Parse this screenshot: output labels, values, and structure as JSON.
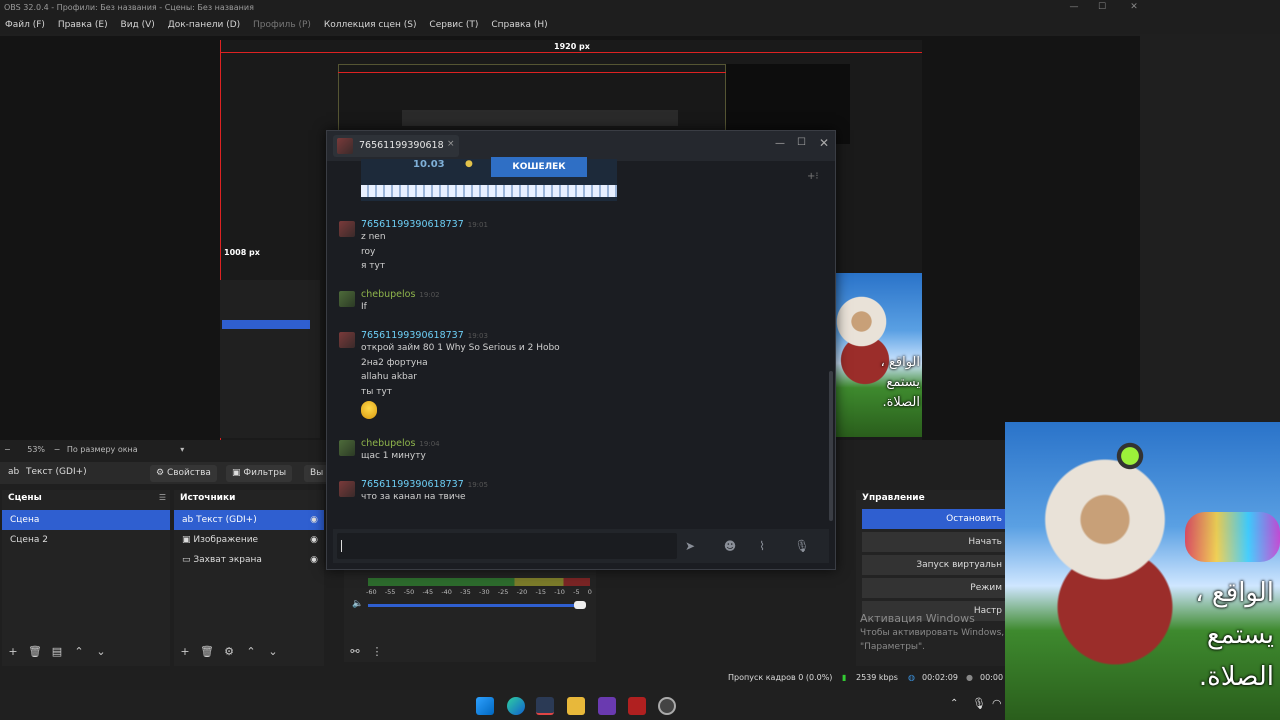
{
  "window": {
    "title": "OBS 32.0.4 - Профили: Без названия - Сцены: Без названия"
  },
  "menu": [
    {
      "label": "Файл (F)",
      "dim": false
    },
    {
      "label": "Правка (E)",
      "dim": false
    },
    {
      "label": "Вид (V)",
      "dim": false
    },
    {
      "label": "Док-панели (D)",
      "dim": false
    },
    {
      "label": "Профиль (P)",
      "dim": true
    },
    {
      "label": "Коллекция сцен (S)",
      "dim": false
    },
    {
      "label": "Сервис (T)",
      "dim": false
    },
    {
      "label": "Справка (H)",
      "dim": false
    }
  ],
  "preview": {
    "width_label": "1920 px",
    "height_label": "1008 px"
  },
  "zoom": {
    "value": "53%",
    "mode": "По размеру окна"
  },
  "source_bar": {
    "current_source": "Текст (GDI+)",
    "properties": "Свойства",
    "filters": "Фильтры",
    "more": "Вы"
  },
  "scenes": {
    "title": "Сцены",
    "items": [
      "Сцена",
      "Сцена 2"
    ]
  },
  "sources": {
    "title": "Источники",
    "items": [
      "Текст (GDI+)",
      "Изображение",
      "Захват экрана"
    ]
  },
  "controls": {
    "title": "Управление",
    "buttons": [
      "Остановить",
      "Начать",
      "Запуск виртуальн",
      "Режим",
      "Настр"
    ]
  },
  "activation": {
    "title": "Активация Windows",
    "line1": "Чтобы активировать Windows,",
    "line2": "\"Параметры\"."
  },
  "mixer": {
    "ticks": [
      "-60",
      "-55",
      "-50",
      "-45",
      "-40",
      "-35",
      "-30",
      "-25",
      "-20",
      "-15",
      "-10",
      "-5",
      "0"
    ]
  },
  "status": {
    "dropped": "Пропуск кадров 0 (0.0%)",
    "bitrate": "2539 kbps",
    "stream_time": "00:02:09",
    "rec_time": "00:00"
  },
  "chat": {
    "tab_name": "76561199390618",
    "wallet_amount": "10.03",
    "wallet_button": "КОШЕЛЕК",
    "messages": [
      {
        "user": "76561199390618737",
        "time": "19:01",
        "color": "blue",
        "lines": [
          "z nen",
          "roy",
          "я тут"
        ]
      },
      {
        "user": "chebupelos",
        "time": "19:02",
        "color": "green",
        "lines": [
          "If"
        ]
      },
      {
        "user": "76561199390618737",
        "time": "19:03",
        "color": "blue",
        "lines": [
          "открой займ 80 1 Why So Serious и 2 Hobo",
          "2на2 фортуна",
          "allahu akbar",
          "ты тут"
        ]
      },
      {
        "user": "chebupelos",
        "time": "19:04",
        "color": "green",
        "lines": [
          "щас 1 минуту"
        ]
      },
      {
        "user": "76561199390618737",
        "time": "19:05",
        "color": "blue",
        "lines": [
          "что за канал на твиче"
        ]
      }
    ]
  },
  "overlay": {
    "arabic_lines": [
      "الواقع ،",
      "يستمع",
      "الصلاة."
    ]
  },
  "colors": {
    "accent": "#2f5fd0",
    "steam_name": "#6dcff6",
    "steam_friend": "#8fb54c",
    "preview_guides": "#dd2222"
  }
}
